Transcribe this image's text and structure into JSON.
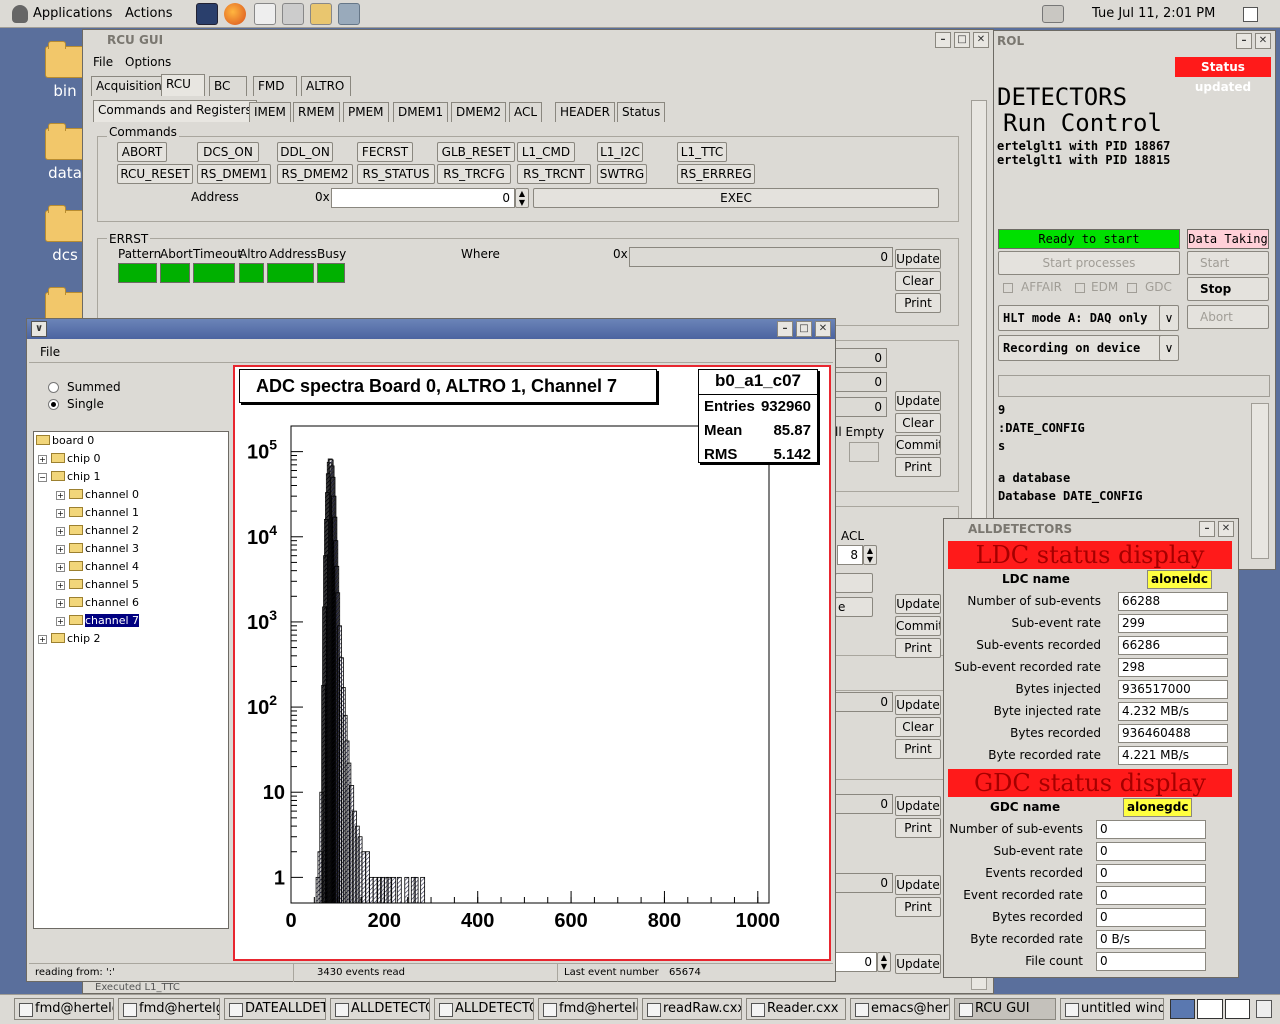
{
  "top_panel": {
    "applications": "Applications",
    "actions": "Actions",
    "datetime": "Tue Jul 11,  2:01 PM"
  },
  "desktop_icons": [
    "bin",
    "data",
    "dcs"
  ],
  "rcu_gui": {
    "title": "RCU GUI",
    "menu": [
      "File",
      "Options"
    ],
    "top_tabs": [
      "Acquisition",
      "RCU",
      "BC",
      "FMD",
      "ALTRO"
    ],
    "sub_tabs": [
      "Commands and Registers",
      "IMEM",
      "RMEM",
      "PMEM",
      "DMEM1",
      "DMEM2",
      "ACL",
      "HEADER",
      "Status"
    ],
    "commands_label": "Commands",
    "commands_row1": [
      "ABORT",
      "DCS_ON",
      "DDL_ON",
      "FECRST",
      "GLB_RESET",
      "L1_CMD",
      "L1_I2C",
      "L1_TTC"
    ],
    "commands_row2": [
      "RCU_RESET",
      "RS_DMEM1",
      "RS_DMEM2",
      "RS_STATUS",
      "RS_TRCFG",
      "RS_TRCNT",
      "SWTRG",
      "RS_ERRREG"
    ],
    "address_label": "Address",
    "hex_prefix": "0x",
    "address_value": "0",
    "exec_label": "EXEC",
    "errst_label": "ERRST",
    "errst_fields": [
      "Pattern",
      "Abort",
      "Timeout",
      "Altro",
      "Address",
      "Busy"
    ],
    "where_label": "Where",
    "where_value": "0",
    "update": "Update",
    "clear": "Clear",
    "print": "Print",
    "commit": "Commit",
    "full_empty": "ll Empty",
    "acl_label": "ACL",
    "acl_value": "8",
    "zero": "0",
    "status_bar_text": "Executed L1_TTC"
  },
  "adc_window": {
    "menu_file": "File",
    "radio_summed": "Summed",
    "radio_single": "Single",
    "tree": {
      "root": "board  0",
      "chips": [
        "chip 0",
        "chip 1",
        "chip 2"
      ],
      "channels": [
        "channel  0",
        "channel  1",
        "channel  2",
        "channel  3",
        "channel  4",
        "channel  5",
        "channel  6",
        "channel  7"
      ]
    },
    "status": {
      "reading_from": "reading from: ':'",
      "events_read": "3430 events read",
      "last_event_label": "Last event number",
      "last_event_value": "65674"
    }
  },
  "chart_data": {
    "type": "bar",
    "title": "ADC spectra Board 0, ALTRO 1, Channel  7",
    "stats": {
      "name": "b0_a1_c07",
      "entries_label": "Entries",
      "entries": "932960",
      "mean_label": "Mean",
      "mean": "85.87",
      "rms_label": "RMS",
      "rms": "5.142"
    },
    "xlim": [
      0,
      1024
    ],
    "y_scale": "log",
    "ylim": [
      0.5,
      200000
    ],
    "x_ticks": [
      "0",
      "200",
      "400",
      "600",
      "800",
      "1000"
    ],
    "y_ticks": [
      "1",
      "10",
      "10^2",
      "10^3",
      "10^4",
      "10^5"
    ],
    "bins": [
      [
        58,
        1
      ],
      [
        62,
        2
      ],
      [
        66,
        10
      ],
      [
        70,
        180
      ],
      [
        72,
        1500
      ],
      [
        74,
        6000
      ],
      [
        76,
        16000
      ],
      [
        78,
        33000
      ],
      [
        80,
        55000
      ],
      [
        82,
        75000
      ],
      [
        84,
        82000
      ],
      [
        86,
        80000
      ],
      [
        88,
        68000
      ],
      [
        90,
        50000
      ],
      [
        92,
        30000
      ],
      [
        94,
        17000
      ],
      [
        96,
        9000
      ],
      [
        98,
        4500
      ],
      [
        100,
        2200
      ],
      [
        104,
        900
      ],
      [
        108,
        380
      ],
      [
        112,
        170
      ],
      [
        116,
        80
      ],
      [
        120,
        40
      ],
      [
        124,
        22
      ],
      [
        130,
        12
      ],
      [
        136,
        6
      ],
      [
        142,
        4
      ],
      [
        148,
        3
      ],
      [
        156,
        2
      ],
      [
        164,
        2
      ],
      [
        172,
        1
      ],
      [
        180,
        1
      ],
      [
        190,
        1
      ],
      [
        196,
        1
      ],
      [
        204,
        1
      ],
      [
        210,
        1
      ],
      [
        220,
        1
      ],
      [
        232,
        1
      ],
      [
        248,
        1
      ],
      [
        262,
        1
      ],
      [
        268,
        1
      ],
      [
        282,
        1
      ]
    ]
  },
  "run_control": {
    "title_fragment": "ROL",
    "status_updated": "Status updated",
    "detectors": "DETECTORS",
    "run_control": "Run Control",
    "pid_lines": [
      "ertelglt1 with PID 18867",
      "ertelglt1 with PID 18815"
    ],
    "ready": "Ready to start",
    "data_taking": "Data Taking",
    "start_processes": "Start processes",
    "start": "Start",
    "stop": "Stop",
    "abort": "Abort",
    "checks": [
      "AFFAIR",
      "EDM",
      "GDC"
    ],
    "hlt_mode": "HLT mode A: DAQ only",
    "recording": "Recording on device",
    "log_lines": [
      "9",
      ":DATE_CONFIG",
      "s",
      "",
      "a database",
      "Database DATE_CONFIG"
    ],
    "colors": {
      "green": "#00e000",
      "pink": "#ffd0d8",
      "red": "#ff1a1a"
    }
  },
  "alldetectors": {
    "title": "ALLDETECTORS",
    "ldc_header": "LDC status display",
    "ldc_name_label": "LDC name",
    "ldc_name": "aloneldc",
    "ldc_rows": [
      [
        "Number of sub-events",
        "66288"
      ],
      [
        "Sub-event rate",
        "299"
      ],
      [
        "Sub-events recorded",
        "66286"
      ],
      [
        "Sub-event recorded rate",
        "298"
      ],
      [
        "Bytes injected",
        "936517000"
      ],
      [
        "Byte injected rate",
        "4.232 MB/s"
      ],
      [
        "Bytes recorded",
        "936460488"
      ],
      [
        "Byte recorded rate",
        "4.221 MB/s"
      ]
    ],
    "gdc_header": "GDC status display",
    "gdc_name_label": "GDC name",
    "gdc_name": "alonegdc",
    "gdc_rows": [
      [
        "Number of sub-events",
        "0"
      ],
      [
        "Sub-event rate",
        "0"
      ],
      [
        "Events recorded",
        "0"
      ],
      [
        "Event recorded rate",
        "0"
      ],
      [
        "Bytes recorded",
        "0"
      ],
      [
        "Byte recorded rate",
        "0 B/s"
      ],
      [
        "File count",
        "0"
      ]
    ]
  },
  "taskbar": [
    "fmd@hertelglt",
    "fmd@hertelglt:",
    "DATEALLDET",
    "ALLDETECTC",
    "ALLDETECTC",
    "fmd@hertelglt:",
    "readRaw.cxx",
    "Reader.cxx",
    "emacs@hertel",
    "RCU GUI",
    "untitled windov"
  ]
}
